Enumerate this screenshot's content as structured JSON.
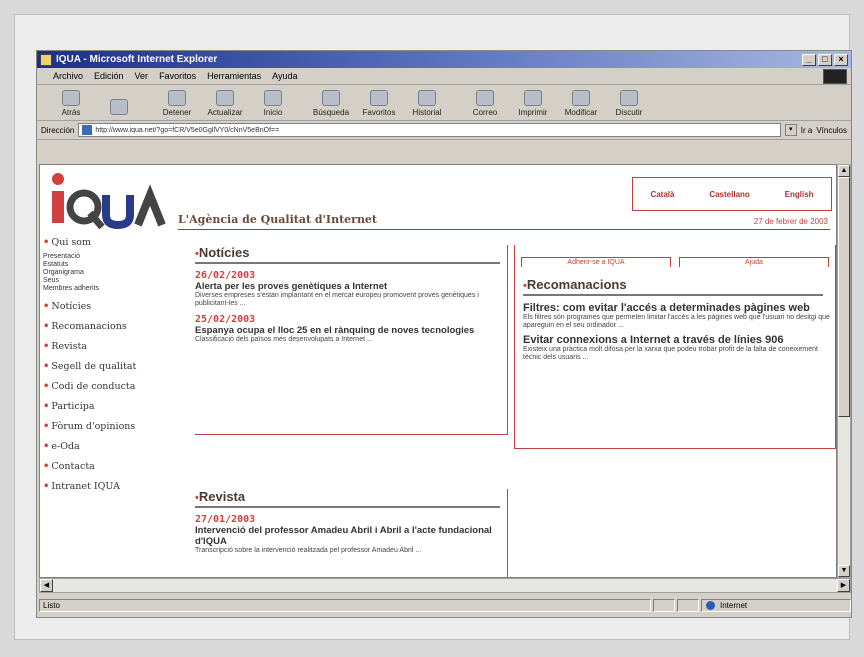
{
  "window": {
    "title": "IQUA - Microsoft Internet Explorer",
    "controls": [
      "_",
      "□",
      "×"
    ]
  },
  "menu": [
    "Archivo",
    "Edición",
    "Ver",
    "Favoritos",
    "Herramientas",
    "Ayuda"
  ],
  "toolbar": [
    {
      "label": "Atrás",
      "icon": "back-icon"
    },
    {
      "label": "",
      "icon": "forward-icon"
    },
    {
      "label": "Detener",
      "icon": "stop-icon"
    },
    {
      "label": "Actualizar",
      "icon": "refresh-icon"
    },
    {
      "label": "Inicio",
      "icon": "home-icon"
    },
    {
      "label": "Búsqueda",
      "icon": "search-icon"
    },
    {
      "label": "Favoritos",
      "icon": "favorites-icon"
    },
    {
      "label": "Historial",
      "icon": "history-icon"
    },
    {
      "label": "Correo",
      "icon": "mail-icon"
    },
    {
      "label": "Imprimir",
      "icon": "print-icon"
    },
    {
      "label": "Modificar",
      "icon": "edit-icon"
    },
    {
      "label": "Discutir",
      "icon": "discuss-icon"
    }
  ],
  "address": {
    "label": "Dirección",
    "url": "http://www.iqua.net/?go=fCR/V5e0GgllVY0/cNnV5eBnOf==",
    "go_label": "Ir a",
    "links_label": "Vínculos"
  },
  "page": {
    "logo_text": "IQUA",
    "tagline": "L'Agència de Qualitat d'Internet",
    "languages": [
      "Català",
      "Castellano",
      "English"
    ],
    "date": "27 de febrer de 2003",
    "nav": [
      {
        "label": "Qui som",
        "subs": [
          "Presentació",
          "Estatuts",
          "Organigrama",
          "Seus",
          "Membres adherits"
        ]
      },
      {
        "label": "Notícies",
        "subs": []
      },
      {
        "label": "Recomanacions",
        "subs": []
      },
      {
        "label": "Revista",
        "subs": []
      },
      {
        "label": "Segell de qualitat",
        "subs": []
      },
      {
        "label": "Codi de conducta",
        "subs": []
      },
      {
        "label": "Participa",
        "subs": []
      },
      {
        "label": "Fòrum d'opinions",
        "subs": []
      },
      {
        "label": "e-Oda",
        "subs": []
      },
      {
        "label": "Contacta",
        "subs": []
      },
      {
        "label": "Intranet IQUA",
        "subs": []
      }
    ],
    "news": {
      "heading": "Notícies",
      "items": [
        {
          "date": "26/02/2003",
          "title": "Alerta per les proves genètiques a Internet",
          "text": "Diverses empreses s'estan implantant en el mercat europeu promovent proves genètiques i publicitant-les ..."
        },
        {
          "date": "25/02/2003",
          "title": "Espanya ocupa el lloc 25 en el rànquing de noves tecnologies",
          "text": "Classificació dels països més desenvolupats a Internet ..."
        }
      ]
    },
    "magazine": {
      "heading": "Revista",
      "items": [
        {
          "date": "27/01/2003",
          "title": "Intervenció del professor Amadeu Abril i Abril a l'acte fundacional d'IQUA",
          "text": "Transcripció sobre la intervenció realitzada pel professor Amadeu Abril ..."
        }
      ]
    },
    "tabs": [
      "Adherir-se a IQUA",
      "Ajuda"
    ],
    "recommendations": {
      "heading": "Recomanacions",
      "items": [
        {
          "title": "Filtres: com evitar l'accés a determinades pàgines web",
          "text": "Els filtres són programes que permeten limitar l'accés a les pàgines web que l'usuari no desitgi que apareguin en el seu ordinador ..."
        },
        {
          "title": "Evitar connexions a Internet a través de línies 906",
          "text": "Existeix una pràctica molt difosa per la xarxa que podeu trobar profit de la falta de coneixement tècnic dels usuaris ..."
        }
      ]
    }
  },
  "status": {
    "text": "Listo",
    "zone": "Internet"
  },
  "colors": {
    "accent": "#d04040",
    "title_bar": "#1b2e8a"
  }
}
